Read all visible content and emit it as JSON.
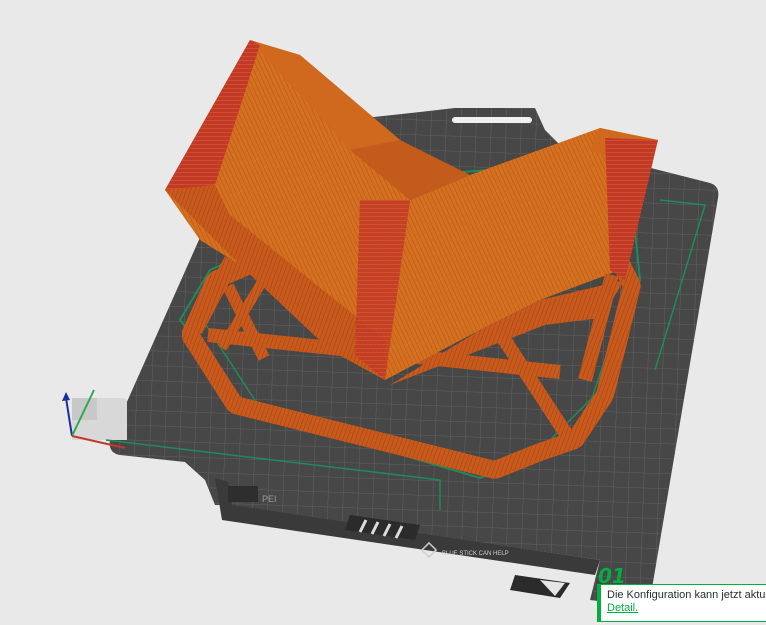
{
  "plate": {
    "number": "01",
    "label": "PEI",
    "logo_text": "BLUE STICK CAN HELP"
  },
  "notification": {
    "message": "Die Konfiguration kann jetzt aktualisiert werden.",
    "link": "Detail."
  },
  "colors": {
    "background": "#e9e9e9",
    "plate": "#474747",
    "grid": "#5f5f5f",
    "model": "#d2691e",
    "model_edge": "#c0392b",
    "brim": "#1f8a5c",
    "accent": "#00ae42"
  },
  "axes": {
    "x": "x-axis",
    "y": "y-axis",
    "z": "z-axis"
  }
}
